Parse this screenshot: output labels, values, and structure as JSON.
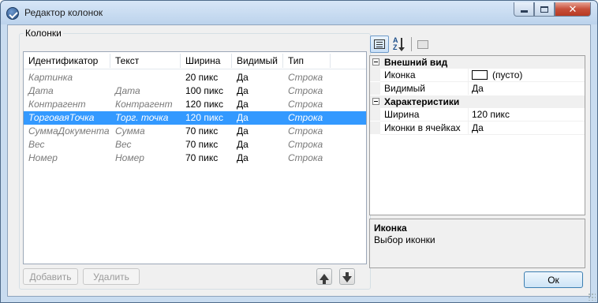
{
  "window": {
    "title": "Редактор колонок",
    "accent": "#3399ff"
  },
  "group": {
    "label": "Колонки"
  },
  "columns_table": {
    "headers": [
      "Идентификатор",
      "Текст",
      "Ширина",
      "Видимый",
      "Тип"
    ],
    "rows": [
      [
        "Картинка",
        "",
        "20 пикс",
        "Да",
        "Строка"
      ],
      [
        "Дата",
        "Дата",
        "100 пикс",
        "Да",
        "Строка"
      ],
      [
        "Контрагент",
        "Контрагент",
        "120 пикс",
        "Да",
        "Строка"
      ],
      [
        "ТорговаяТочка",
        "Торг. точка",
        "120 пикс",
        "Да",
        "Строка"
      ],
      [
        "СуммаДокумента",
        "Сумма",
        "70 пикс",
        "Да",
        "Строка"
      ],
      [
        "Вес",
        "Вес",
        "70 пикс",
        "Да",
        "Строка"
      ],
      [
        "Номер",
        "Номер",
        "70 пикс",
        "Да",
        "Строка"
      ]
    ],
    "selected_index": 3
  },
  "buttons": {
    "add": "Добавить",
    "delete": "Удалить",
    "ok": "Ок"
  },
  "property_grid": {
    "categories": [
      {
        "name": "Внешний вид",
        "properties": [
          {
            "name": "Иконка",
            "value": "(пусто)"
          },
          {
            "name": "Видимый",
            "value": "Да"
          }
        ]
      },
      {
        "name": "Характеристики",
        "properties": [
          {
            "name": "Ширина",
            "value": "120 пикс"
          },
          {
            "name": "Иконки в ячейках",
            "value": "Да"
          }
        ]
      }
    ]
  },
  "help": {
    "title": "Иконка",
    "description": "Выбор иконки"
  },
  "icons": {
    "app": "app-icon",
    "categorized": "categorized-icon",
    "alphabetical": "sort-alpha-icon",
    "property_pages": "property-pages-icon",
    "move_up": "arrow-up-icon",
    "move_down": "arrow-down-icon"
  }
}
